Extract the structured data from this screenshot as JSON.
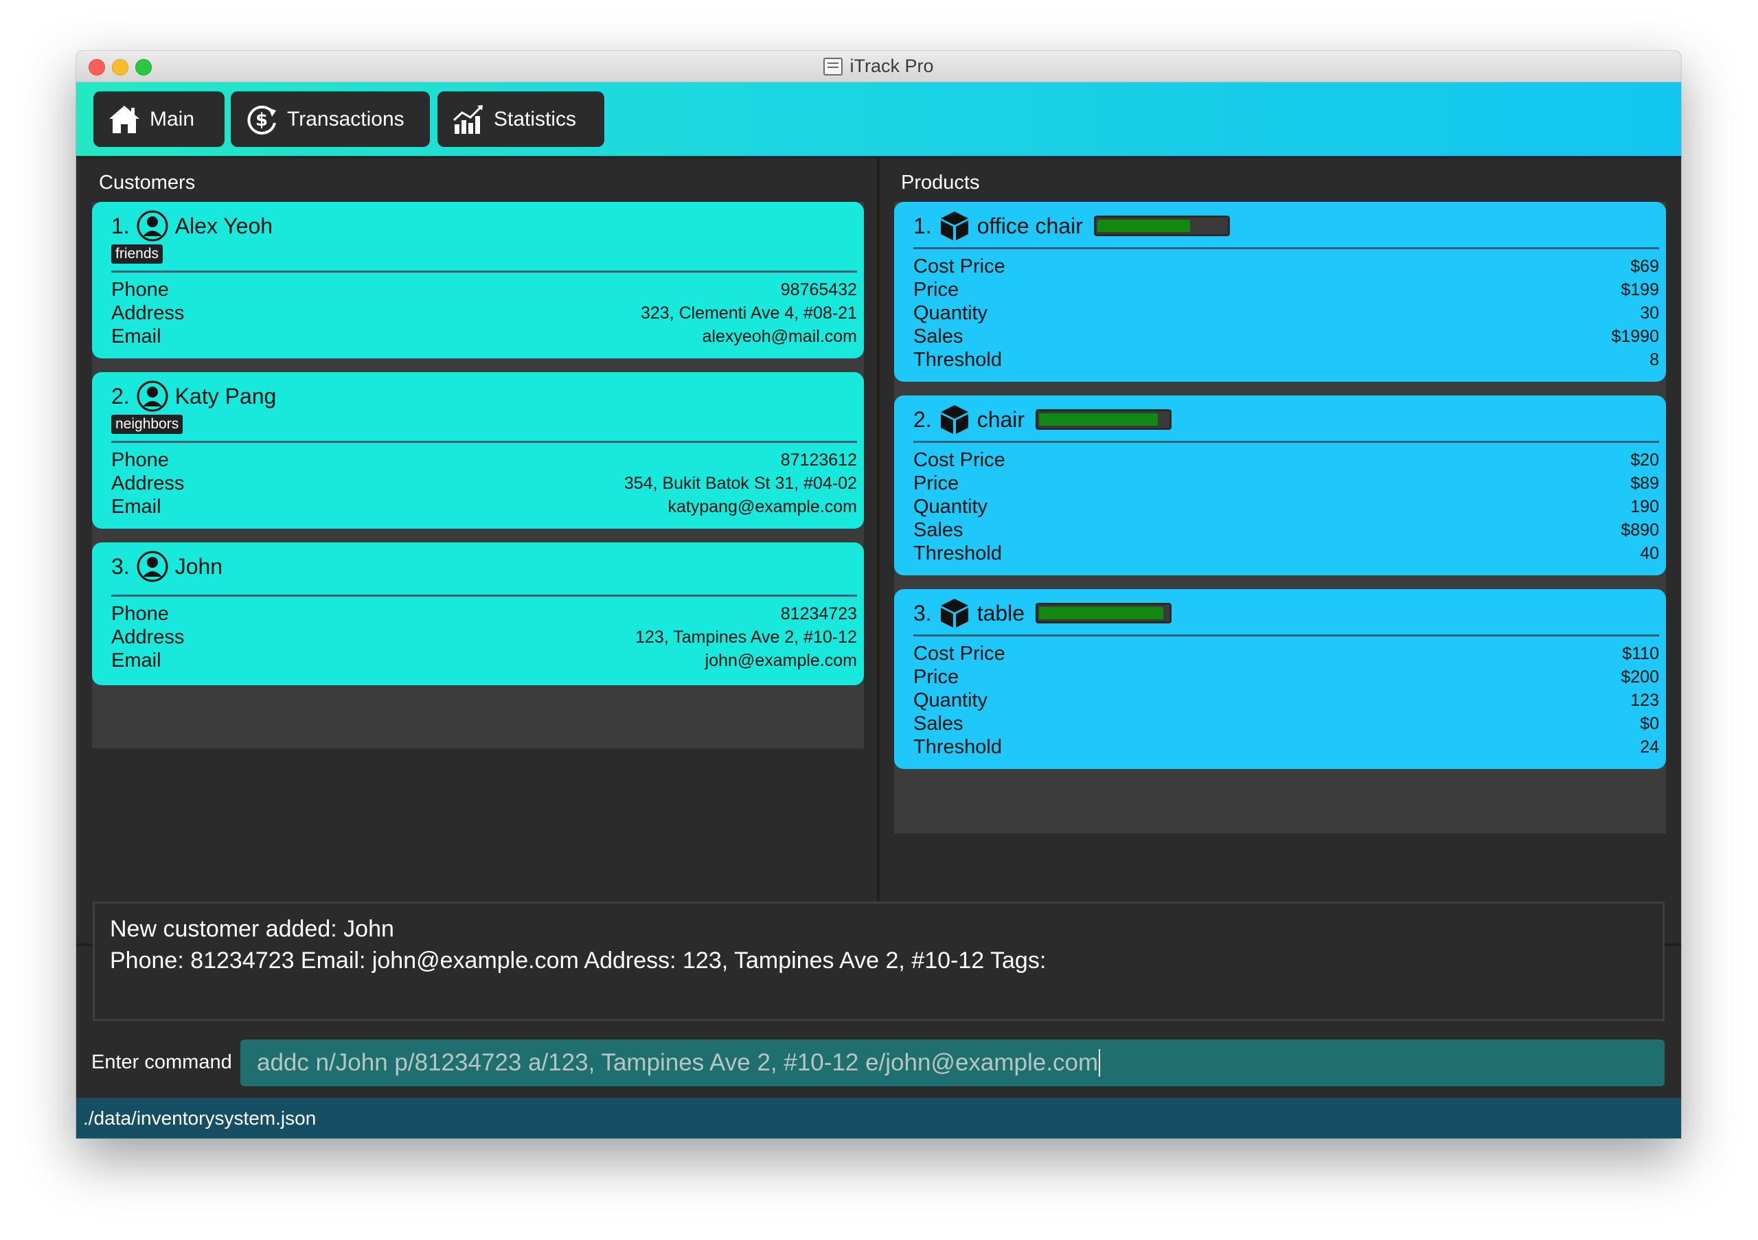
{
  "window": {
    "title": "iTrack Pro"
  },
  "nav": {
    "main_label": "Main",
    "transactions_label": "Transactions",
    "statistics_label": "Statistics"
  },
  "customers": {
    "header": "Customers",
    "items": [
      {
        "index": "1.",
        "name": "Alex Yeoh",
        "tag": "friends",
        "phone": "98765432",
        "address": "323, Clementi Ave 4, #08-21",
        "email": "alexyeoh@mail.com"
      },
      {
        "index": "2.",
        "name": "Katy Pang",
        "tag": "neighbors",
        "phone": "87123612",
        "address": "354, Bukit Batok St 31, #04-02",
        "email": "katypang@example.com"
      },
      {
        "index": "3.",
        "name": "John",
        "phone": "81234723",
        "address": "123, Tampines Ave 2, #10-12",
        "email": "john@example.com"
      }
    ]
  },
  "labels": {
    "phone": "Phone",
    "address": "Address",
    "email": "Email",
    "cost_price": "Cost Price",
    "price": "Price",
    "quantity": "Quantity",
    "sales": "Sales",
    "threshold": "Threshold"
  },
  "products": {
    "header": "Products",
    "items": [
      {
        "index": "1.",
        "name": "office chair",
        "stock_level": 0.72,
        "cost_price": "$69",
        "price": "$199",
        "quantity": "30",
        "sales": "$1990",
        "threshold": "8"
      },
      {
        "index": "2.",
        "name": "chair",
        "stock_level": 0.92,
        "cost_price": "$20",
        "price": "$89",
        "quantity": "190",
        "sales": "$890",
        "threshold": "40"
      },
      {
        "index": "3.",
        "name": "table",
        "stock_level": 0.96,
        "cost_price": "$110",
        "price": "$200",
        "quantity": "123",
        "sales": "$0",
        "threshold": "24"
      }
    ]
  },
  "result": {
    "line1": "New customer added: John",
    "line2": "Phone: 81234723 Email: john@example.com Address: 123, Tampines Ave 2, #10-12 Tags:"
  },
  "command": {
    "label": "Enter command",
    "value": "addc n/John p/81234723 a/123, Tampines Ave 2, #10-12 e/john@example.com"
  },
  "status": {
    "file_path": "./data/inventorysystem.json"
  },
  "colors": {
    "customer_card": "#18e9dd",
    "product_card": "#1ec8fa",
    "stock_fill": "#128a12",
    "status_bar": "#164e63",
    "command_field": "#1f6f6e"
  }
}
